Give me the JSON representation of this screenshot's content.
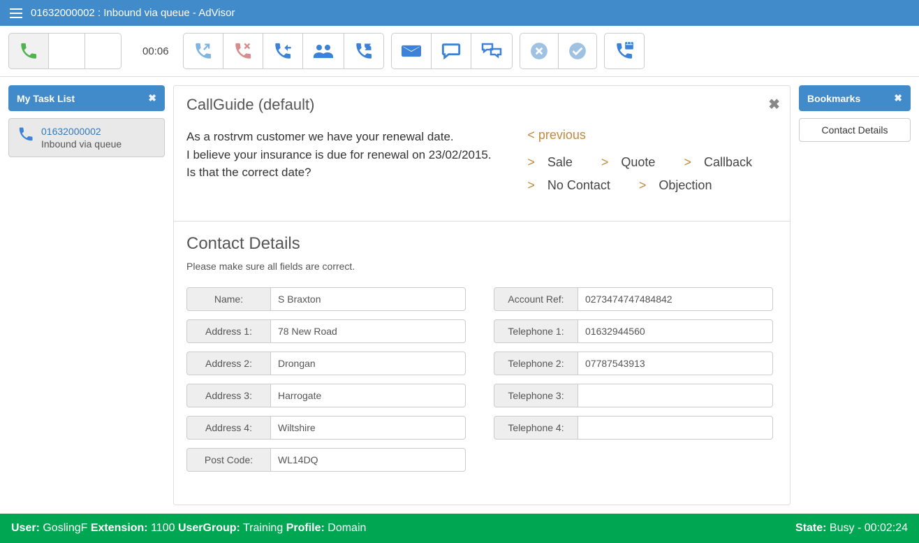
{
  "header": {
    "title": "01632000002 : Inbound via queue - AdVisor"
  },
  "timer": "00:06",
  "tasklist": {
    "title": "My Task List",
    "item": {
      "number": "01632000002",
      "sub": "Inbound via queue"
    }
  },
  "guide": {
    "title": "CallGuide (default)",
    "line1": "As a rostrvm customer we have your renewal date.",
    "line2": "I believe your insurance is due for renewal on 23/02/2015.",
    "line3": "Is that the correct date?",
    "nav": {
      "prev": "< previous",
      "sale": "Sale",
      "quote": "Quote",
      "callback": "Callback",
      "nocontact": "No Contact",
      "objection": "Objection"
    }
  },
  "contact": {
    "heading": "Contact Details",
    "sub": "Please make sure all fields are correct.",
    "labels": {
      "name": "Name:",
      "addr1": "Address 1:",
      "addr2": "Address 2:",
      "addr3": "Address 3:",
      "addr4": "Address 4:",
      "post": "Post Code:",
      "acct": "Account Ref:",
      "tel1": "Telephone 1:",
      "tel2": "Telephone 2:",
      "tel3": "Telephone 3:",
      "tel4": "Telephone 4:"
    },
    "values": {
      "name": "S Braxton",
      "addr1": "78 New Road",
      "addr2": "Drongan",
      "addr3": "Harrogate",
      "addr4": "Wiltshire",
      "post": "WL14DQ",
      "acct": "0273474747484842",
      "tel1": "01632944560",
      "tel2": "07787543913",
      "tel3": "",
      "tel4": ""
    }
  },
  "bookmarks": {
    "title": "Bookmarks",
    "item1": "Contact Details"
  },
  "status": {
    "user_lbl": "User:",
    "user_val": "GoslingF",
    "ext_lbl": "Extension:",
    "ext_val": "1100",
    "ug_lbl": "UserGroup:",
    "ug_val": "Training",
    "pf_lbl": "Profile:",
    "pf_val": "Domain",
    "state_lbl": "State:",
    "state_val": "Busy - 00:02:24"
  }
}
